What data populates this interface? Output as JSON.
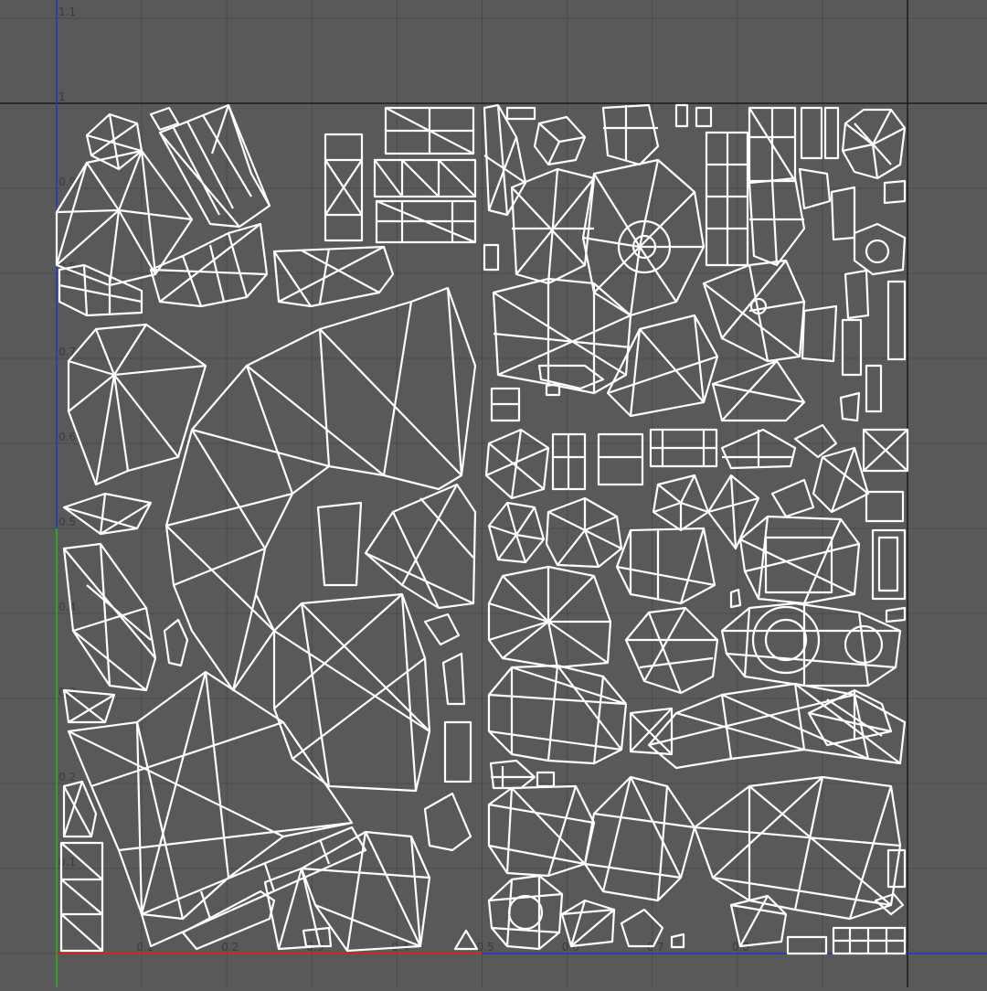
{
  "editor": {
    "panel": "UV Editor",
    "space": "0 to 1 UV space",
    "colors": {
      "background": "#595959",
      "grid_line": "#4a4a4a",
      "boundary": "#1c1c1c",
      "u_axis": "#c8281e",
      "v_axis": "#2aa52a",
      "axis_extension": "#2233cc",
      "wireframe": "#ffffff",
      "tick_text": "#3c3c3c"
    }
  },
  "u_ticks": [
    {
      "value": 0.1,
      "label": "0.1"
    },
    {
      "value": 0.2,
      "label": "0.2"
    },
    {
      "value": 0.3,
      "label": "0.3"
    },
    {
      "value": 0.4,
      "label": "0.4"
    },
    {
      "value": 0.5,
      "label": "0.5"
    },
    {
      "value": 0.6,
      "label": "0.6"
    },
    {
      "value": 0.7,
      "label": "0.7"
    },
    {
      "value": 0.8,
      "label": "0.8"
    },
    {
      "value": 1.0,
      "label": "1"
    }
  ],
  "v_ticks": [
    {
      "value": 1.1,
      "label": "1.1"
    },
    {
      "value": 1.0,
      "label": "1"
    },
    {
      "value": 0.9,
      "label": "0.9"
    },
    {
      "value": 0.8,
      "label": "0.8"
    },
    {
      "value": 0.7,
      "label": "0.7"
    },
    {
      "value": 0.6,
      "label": "0.6"
    },
    {
      "value": 0.5,
      "label": "0.5"
    },
    {
      "value": 0.4,
      "label": "0.4"
    },
    {
      "value": 0.3,
      "label": "0.3"
    },
    {
      "value": 0.2,
      "label": "0.2"
    },
    {
      "value": 0.1,
      "label": "0.1"
    }
  ]
}
